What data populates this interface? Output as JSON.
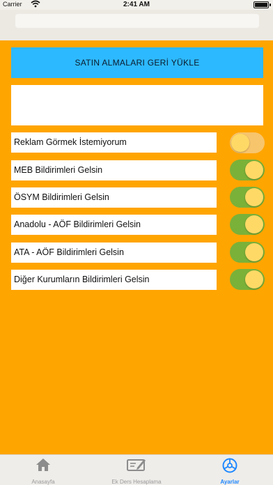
{
  "status_bar": {
    "carrier": "Carrier",
    "time": "2:41 AM",
    "wifi_icon": "wifi-icon",
    "battery_icon": "battery-icon"
  },
  "restore_button": {
    "label": "SATIN ALMALARI GERİ YÜKLE",
    "color": "#2db9ff"
  },
  "settings": [
    {
      "label": "Reklam Görmek İstemiyorum",
      "enabled": false
    },
    {
      "label": "MEB Bildirimleri Gelsin",
      "enabled": true
    },
    {
      "label": "ÖSYM Bildirimleri Gelsin",
      "enabled": true
    },
    {
      "label": "Anadolu - AÖF Bildirimleri Gelsin",
      "enabled": true
    },
    {
      "label": "ATA - AÖF Bildirimleri Gelsin",
      "enabled": true
    },
    {
      "label": "Diğer Kurumların Bildirimleri Gelsin",
      "enabled": true
    }
  ],
  "tabs": [
    {
      "label": "Anasayfa",
      "icon": "home-icon",
      "active": false
    },
    {
      "label": "Ek Ders Hesaplama",
      "icon": "calculator-edit-icon",
      "active": false
    },
    {
      "label": "Ayarlar",
      "icon": "settings-icon",
      "active": true
    }
  ],
  "colors": {
    "background": "#ffa500",
    "toggle_on": "#7ab139",
    "toggle_off": "#f7c56c",
    "tab_active": "#1e88ff"
  }
}
